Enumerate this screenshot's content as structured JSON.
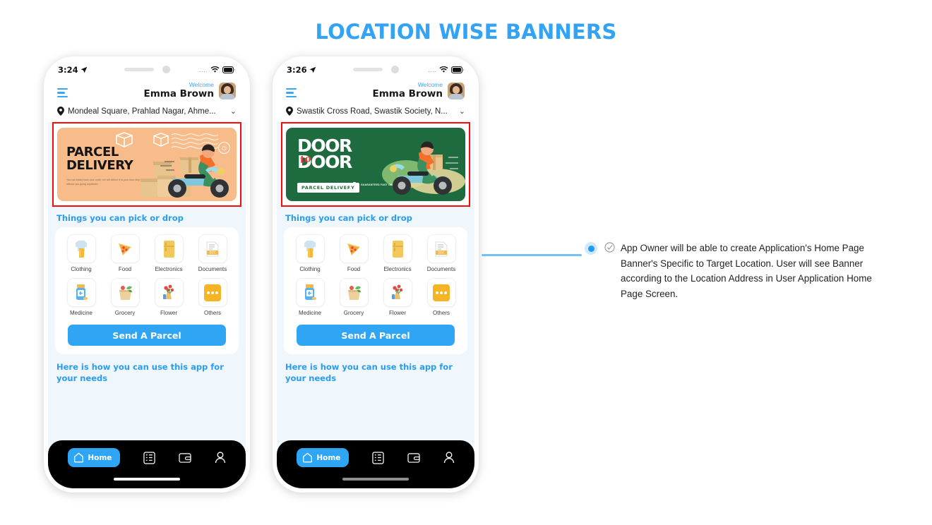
{
  "page": {
    "title": "LOCATION WISE BANNERS",
    "title_color": "#33a3f5"
  },
  "phones": [
    {
      "id": "phone-1",
      "status": {
        "time": "3:24",
        "location_arrow": "➤",
        "signal_dots": "....",
        "wifi": "wifi-icon",
        "battery": "battery-icon"
      },
      "header": {
        "menu": "hamburger-menu-icon",
        "welcome": "Welcome",
        "username": "Emma Brown",
        "avatar": "user-avatar"
      },
      "address": {
        "pin": "location-pin-icon",
        "text": "Mondeal Square, Prahlad Nagar, Ahme...",
        "chevron": "chevron-down-icon"
      },
      "banner": {
        "variant": "parcel-delivery",
        "title_line1": "PARCEL",
        "title_line2": "DELIVERY",
        "subtext": "You can easily track your order, we will deliver it to your door step without you going anywhere.",
        "bg_color": "#f7bc8a",
        "badge": "clock-icon"
      },
      "section_title": "Things you can pick or drop",
      "categories": [
        {
          "label": "Clothing",
          "icon": "clothing-icon"
        },
        {
          "label": "Food",
          "icon": "pizza-icon"
        },
        {
          "label": "Electronics",
          "icon": "refrigerator-icon"
        },
        {
          "label": "Documents",
          "icon": "documents-icon"
        },
        {
          "label": "Medicine",
          "icon": "medicine-bottle-icon"
        },
        {
          "label": "Grocery",
          "icon": "grocery-bag-icon"
        },
        {
          "label": "Flower",
          "icon": "flower-bouquet-icon"
        },
        {
          "label": "Others",
          "icon": "ellipsis-icon"
        }
      ],
      "cta": "Send A Parcel",
      "footer_title": "Here is how you can use this app for your needs",
      "tabbar": [
        {
          "label": "Home",
          "icon": "home-icon",
          "active": true
        },
        {
          "label": "",
          "icon": "orders-list-icon",
          "active": false
        },
        {
          "label": "",
          "icon": "wallet-icon",
          "active": false
        },
        {
          "label": "",
          "icon": "profile-icon",
          "active": false
        }
      ],
      "home_indicator_color": "#ffffff"
    },
    {
      "id": "phone-2",
      "status": {
        "time": "3:26",
        "location_arrow": "➤",
        "signal_dots": "....",
        "wifi": "wifi-icon",
        "battery": "battery-icon"
      },
      "header": {
        "menu": "hamburger-menu-icon",
        "welcome": "Welcome",
        "username": "Emma Brown",
        "avatar": "user-avatar"
      },
      "address": {
        "pin": "location-pin-icon",
        "text": "Swastik Cross Road, Swastik Society, N...",
        "chevron": "chevron-down-icon"
      },
      "banner": {
        "variant": "door-to-door",
        "title_line1": "DOOR",
        "title_script": "to",
        "title_line2": "DOOR",
        "pill": "PARCEL DELIVERY",
        "guarantee": "GUARANTEED FAST DELIVERY",
        "bg_color": "#1e6b3f",
        "badge": "stopwatch-icon"
      },
      "section_title": "Things you can pick or drop",
      "categories": [
        {
          "label": "Clothing",
          "icon": "clothing-icon"
        },
        {
          "label": "Food",
          "icon": "pizza-icon"
        },
        {
          "label": "Electronics",
          "icon": "refrigerator-icon"
        },
        {
          "label": "Documents",
          "icon": "documents-icon"
        },
        {
          "label": "Medicine",
          "icon": "medicine-bottle-icon"
        },
        {
          "label": "Grocery",
          "icon": "grocery-bag-icon"
        },
        {
          "label": "Flower",
          "icon": "flower-bouquet-icon"
        },
        {
          "label": "Others",
          "icon": "ellipsis-icon"
        }
      ],
      "cta": "Send A Parcel",
      "footer_title": "Here is how you can use this app for your needs",
      "tabbar": [
        {
          "label": "Home",
          "icon": "home-icon",
          "active": true
        },
        {
          "label": "",
          "icon": "orders-list-icon",
          "active": false
        },
        {
          "label": "",
          "icon": "wallet-icon",
          "active": false
        },
        {
          "label": "",
          "icon": "profile-icon",
          "active": false
        }
      ],
      "home_indicator_color": "#8b8e92"
    }
  ],
  "annotation": {
    "bullet": "bullet-dot",
    "check_icon": "check-circle-icon",
    "text": "App Owner will be able to create Application's Home Page Banner's Specific to Target Location. User will see Banner according to the Location Address in User Application Home Page Screen."
  },
  "colors": {
    "accent_blue": "#2b9cf0",
    "highlight_red": "#fb0a0a",
    "app_bg": "#eff6fc",
    "connector": "#74c2f3"
  }
}
